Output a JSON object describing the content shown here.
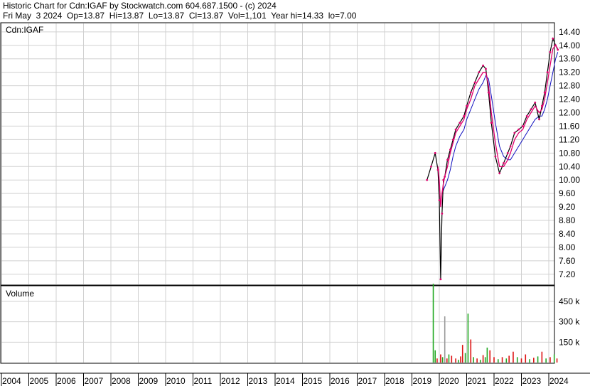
{
  "header": {
    "title": "Historic Chart for Cdn:IGAF by Stockwatch.com 604.687.1500 - (c) 2024",
    "date": "Fri May  3 2024",
    "op_label": "Op=13.87",
    "hi_label": "Hi=13.87",
    "lo_label": "Lo=13.87",
    "cl_label": "Cl=13.87",
    "vol_label": "Vol=1,101",
    "year_hi_label": "Year hi=14.33",
    "year_lo_label": "lo=7.00"
  },
  "chart_data": [
    {
      "type": "line",
      "title": "Cdn:IGAF",
      "ylim": [
        6.9,
        14.65
      ],
      "yticks": [
        "14.40",
        "14.00",
        "13.60",
        "13.20",
        "12.80",
        "12.40",
        "12.00",
        "11.60",
        "11.20",
        "10.80",
        "10.40",
        "10.00",
        "9.60",
        "9.20",
        "8.80",
        "8.40",
        "8.00",
        "7.60",
        "7.20"
      ],
      "x": [
        2019.55,
        2019.7,
        2019.85,
        2019.95,
        2020.0,
        2020.05,
        2020.1,
        2020.15,
        2020.2,
        2020.3,
        2020.4,
        2020.5,
        2020.6,
        2020.75,
        2020.9,
        2021.0,
        2021.15,
        2021.3,
        2021.45,
        2021.6,
        2021.7,
        2021.8,
        2021.9,
        2022.05,
        2022.2,
        2022.35,
        2022.5,
        2022.6,
        2022.75,
        2022.9,
        2023.05,
        2023.2,
        2023.35,
        2023.5,
        2023.65,
        2023.75,
        2023.85,
        2023.95,
        2024.05,
        2024.15,
        2024.25,
        2024.33
      ],
      "series": [
        {
          "name": "price",
          "values": [
            10.0,
            10.4,
            10.8,
            10.3,
            9.4,
            7.05,
            9.0,
            10.0,
            10.1,
            10.6,
            10.9,
            11.2,
            11.5,
            11.7,
            11.9,
            12.2,
            12.6,
            12.9,
            13.2,
            13.4,
            13.3,
            12.6,
            11.7,
            10.7,
            10.2,
            10.5,
            10.8,
            11.0,
            11.4,
            11.5,
            11.6,
            11.9,
            12.1,
            12.3,
            11.8,
            12.2,
            12.6,
            13.2,
            13.8,
            14.2,
            14.0,
            13.87
          ]
        },
        {
          "name": "ma-short",
          "values": [
            null,
            null,
            null,
            10.4,
            10.0,
            9.2,
            9.6,
            9.9,
            10.1,
            10.4,
            10.8,
            11.1,
            11.4,
            11.6,
            11.8,
            12.1,
            12.4,
            12.8,
            13.0,
            13.2,
            13.2,
            12.8,
            12.0,
            11.1,
            10.4,
            10.4,
            10.6,
            10.8,
            11.2,
            11.4,
            11.5,
            11.8,
            12.0,
            12.2,
            12.0,
            12.1,
            12.4,
            12.9,
            13.4,
            13.9,
            14.0,
            13.9
          ]
        },
        {
          "name": "ma-long",
          "values": [
            null,
            null,
            null,
            null,
            null,
            null,
            9.6,
            9.7,
            9.8,
            10.0,
            10.3,
            10.7,
            11.0,
            11.3,
            11.5,
            11.8,
            12.1,
            12.4,
            12.7,
            12.9,
            13.1,
            13.0,
            12.5,
            11.7,
            11.0,
            10.7,
            10.6,
            10.6,
            10.8,
            11.0,
            11.2,
            11.4,
            11.6,
            11.8,
            11.9,
            11.9,
            12.1,
            12.4,
            12.8,
            13.2,
            13.6,
            13.8
          ]
        }
      ]
    },
    {
      "type": "bar",
      "title": "Volume",
      "ylim": [
        0,
        560
      ],
      "yticks": [
        {
          "v": 450,
          "label": "450 k"
        },
        {
          "v": 300,
          "label": "300 k"
        },
        {
          "v": 150,
          "label": "150 k"
        }
      ],
      "x": [
        2019.78,
        2019.85,
        2019.92,
        2020.05,
        2020.12,
        2020.2,
        2020.28,
        2020.35,
        2020.45,
        2020.6,
        2020.7,
        2020.78,
        2020.85,
        2020.95,
        2021.05,
        2021.15,
        2021.25,
        2021.38,
        2021.5,
        2021.6,
        2021.68,
        2021.75,
        2021.85,
        2022.0,
        2022.15,
        2022.3,
        2022.45,
        2022.55,
        2022.7,
        2022.85,
        2023.0,
        2023.15,
        2023.3,
        2023.45,
        2023.6,
        2023.75,
        2023.9,
        2024.05,
        2024.2,
        2024.3
      ],
      "values": [
        580,
        90,
        30,
        60,
        40,
        340,
        30,
        60,
        50,
        30,
        20,
        45,
        130,
        70,
        360,
        170,
        40,
        30,
        20,
        55,
        40,
        110,
        90,
        40,
        25,
        40,
        30,
        50,
        80,
        40,
        30,
        60,
        25,
        35,
        45,
        80,
        30,
        40,
        60,
        30
      ],
      "colors": [
        "g",
        "g",
        "r",
        "r",
        "g",
        "s",
        "r",
        "g",
        "r",
        "r",
        "g",
        "r",
        "r",
        "g",
        "g",
        "r",
        "g",
        "r",
        "g",
        "r",
        "g",
        "g",
        "r",
        "r",
        "g",
        "r",
        "g",
        "r",
        "r",
        "g",
        "r",
        "r",
        "g",
        "r",
        "g",
        "r",
        "g",
        "r",
        "g",
        "r"
      ]
    }
  ],
  "x_axis": {
    "years": [
      "2004",
      "2005",
      "2006",
      "2007",
      "2008",
      "2009",
      "2010",
      "2011",
      "2012",
      "2013",
      "2014",
      "2015",
      "2016",
      "2017",
      "2018",
      "2019",
      "2020",
      "2021",
      "2022",
      "2023",
      "2024"
    ]
  },
  "colors": {
    "price": "#000000",
    "ma_short": "#e0006e",
    "ma_long": "#1010c0",
    "vol_green": "#22a822",
    "vol_red": "#dd1111",
    "vol_grey": "#999999",
    "grid": "#d0d0d0"
  }
}
